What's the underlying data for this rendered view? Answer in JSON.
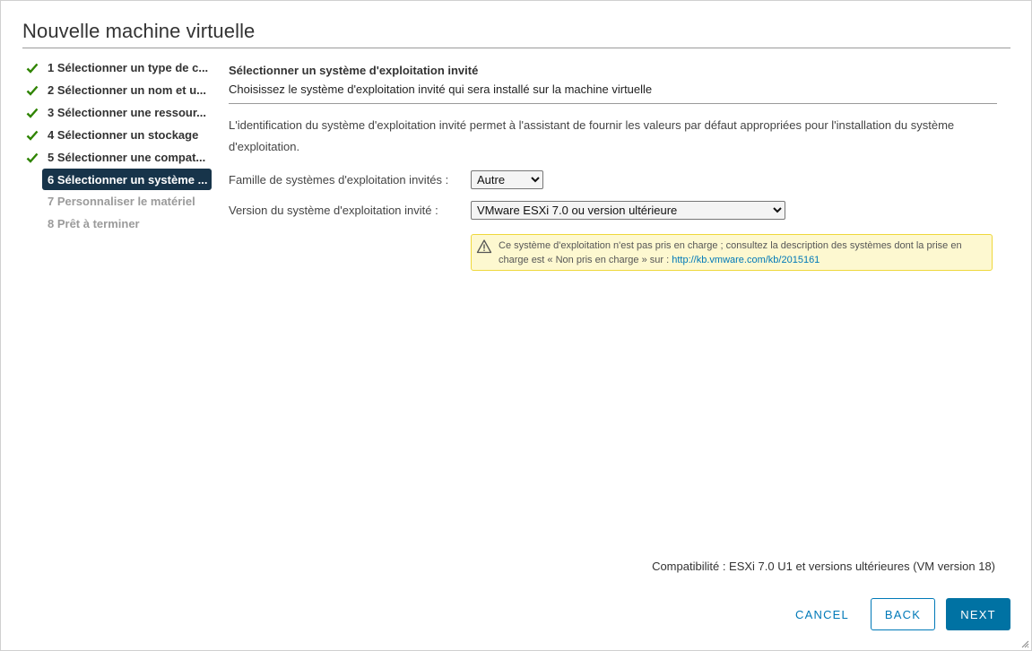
{
  "dialog": {
    "title": "Nouvelle machine virtuelle"
  },
  "steps": [
    {
      "label": "1 Sélectionner un type de c...",
      "state": "done"
    },
    {
      "label": "2 Sélectionner un nom et u...",
      "state": "done"
    },
    {
      "label": "3 Sélectionner une ressour...",
      "state": "done"
    },
    {
      "label": "4 Sélectionner un stockage",
      "state": "done"
    },
    {
      "label": "5 Sélectionner une compat...",
      "state": "done"
    },
    {
      "label": "6 Sélectionner un système ...",
      "state": "active"
    },
    {
      "label": "7 Personnaliser le matériel",
      "state": "pending"
    },
    {
      "label": "8 Prêt à terminer",
      "state": "pending"
    }
  ],
  "main": {
    "title": "Sélectionner un système d'exploitation invité",
    "subtitle": "Choisissez le système d'exploitation invité qui sera installé sur la machine virtuelle",
    "description": "L'identification du système d'exploitation invité permet à l'assistant de fournir les valeurs par défaut appropriées pour l'installation du système d'exploitation.",
    "family": {
      "label": "Famille de systèmes d'exploitation invités :",
      "value": "Autre"
    },
    "version": {
      "label": "Version du système d'exploitation invité :",
      "value": "VMware ESXi 7.0 ou version ultérieure"
    },
    "warning": {
      "text": "Ce système d'exploitation n'est pas pris en charge ; consultez la description des systèmes dont la prise en charge est « Non pris en charge » sur : ",
      "link": "http://kb.vmware.com/kb/2015161"
    }
  },
  "compatibility": "Compatibilité : ESXi 7.0 U1 et versions ultérieures (VM version 18)",
  "buttons": {
    "cancel": "CANCEL",
    "back": "BACK",
    "next": "NEXT"
  },
  "colors": {
    "accent": "#0079b8",
    "primary": "#0072a3",
    "active_step": "#17344a",
    "check": "#2f8400",
    "warning_bg": "#fdf8d0"
  }
}
